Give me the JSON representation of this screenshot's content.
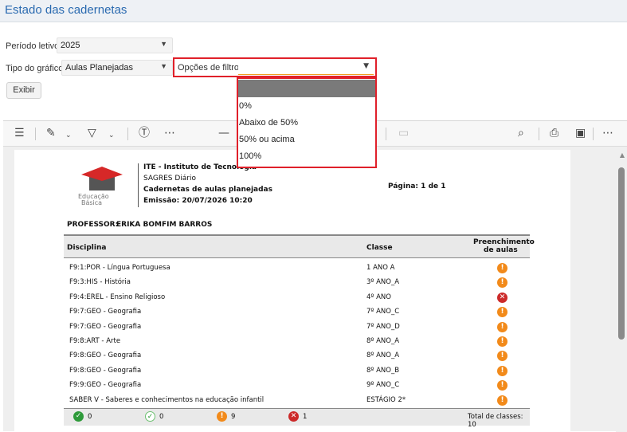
{
  "page": {
    "title": "Estado das cadernetas"
  },
  "form": {
    "periodo_label": "Período letivo:",
    "periodo_value": "2025",
    "tipo_label": "Tipo do gráfico:",
    "tipo_value": "Aulas Planejadas",
    "filtro_label": "Opções de filtro:",
    "filtro_value": "",
    "exibir_label": "Exibir"
  },
  "dropdown": {
    "options": [
      "",
      "0%",
      "Abaixo de 50%",
      "50% ou acima",
      "100%"
    ]
  },
  "toolbar": {
    "icons": [
      "list-icon",
      "highlight-icon",
      "draw-icon",
      "text-icon",
      "more-icon",
      "zoom-out-icon",
      "rotate-icon",
      "page-view-icon",
      "search-icon",
      "print-icon",
      "save-icon",
      "more-options-icon"
    ]
  },
  "report": {
    "logo_text1": "Educação",
    "logo_text2": "Básica",
    "institution": "ITE - Instituto de Tecnologia",
    "system": "SAGRES Diário",
    "doc_title": "Cadernetas de aulas planejadas",
    "emission": "Emissão: 20/07/2026 10:20",
    "page": "Página: 1 de 1",
    "professor_label": "PROFESSOR:",
    "professor_name": "ERIKA BOMFIM BARROS",
    "col_disciplina": "Disciplina",
    "col_classe": "Classe",
    "col_preench_1": "Preenchimento",
    "col_preench_2": "de aulas",
    "rows": [
      {
        "disciplina": "F9:1:POR - Língua Portuguesa",
        "classe": "1 ANO A",
        "status": "warn",
        "glyph": "!"
      },
      {
        "disciplina": "F9:3:HIS - História",
        "classe": "3º ANO_A",
        "status": "warn",
        "glyph": "!"
      },
      {
        "disciplina": "F9:4:EREL - Ensino Religioso",
        "classe": "4º ANO",
        "status": "err",
        "glyph": "✕"
      },
      {
        "disciplina": "F9:7:GEO - Geografia",
        "classe": "7º ANO_C",
        "status": "warn",
        "glyph": "!"
      },
      {
        "disciplina": "F9:7:GEO - Geografia",
        "classe": "7º ANO_D",
        "status": "warn",
        "glyph": "!"
      },
      {
        "disciplina": "F9:8:ART - Arte",
        "classe": "8º ANO_A",
        "status": "warn",
        "glyph": "!"
      },
      {
        "disciplina": "F9:8:GEO - Geografia",
        "classe": "8º ANO_A",
        "status": "warn",
        "glyph": "!"
      },
      {
        "disciplina": "F9:8:GEO - Geografia",
        "classe": "8º ANO_B",
        "status": "warn",
        "glyph": "!"
      },
      {
        "disciplina": "F9:9:GEO - Geografia",
        "classe": "9º ANO_C",
        "status": "warn",
        "glyph": "!"
      },
      {
        "disciplina": "SABER V - Saberes e conhecimentos na educação infantil",
        "classe": "ESTÁGIO 2*",
        "status": "warn",
        "glyph": "!"
      }
    ],
    "footer": {
      "complete_count": "0",
      "partial_count": "0",
      "warn_count": "9",
      "err_count": "1",
      "total": "Total de classes: 10"
    }
  },
  "colors": {
    "accent": "#2a6ab0",
    "highlight": "#e0202a",
    "warn": "#f28a1a",
    "error": "#cc2a2a",
    "ok": "#2e9a3a"
  }
}
